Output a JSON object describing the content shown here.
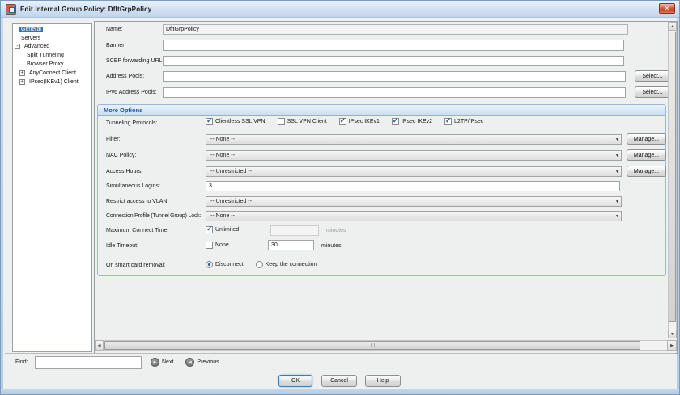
{
  "window": {
    "title": "Edit Internal Group Policy: DfltGrpPolicy"
  },
  "icons": {
    "close": "✕",
    "dropdown_arrow": "▼",
    "check": "✓",
    "next_arrow": "▶",
    "previous_arrow": "◀",
    "scroll_up": "▲",
    "scroll_down": "▼",
    "scroll_left": "◀",
    "scroll_right": "▶",
    "expand_plus": "+",
    "expand_minus": "-"
  },
  "tree": {
    "items": [
      {
        "label": "General",
        "selected": true
      },
      {
        "label": "Servers"
      },
      {
        "label": "Advanced",
        "expander": "-"
      },
      {
        "label": "Split Tunneling"
      },
      {
        "label": "Browser Proxy"
      },
      {
        "label": "AnyConnect Client",
        "expander": "+"
      },
      {
        "label": "IPsec(IKEv1) Client",
        "expander": "+"
      }
    ]
  },
  "form": {
    "name": {
      "label": "Name:",
      "value": "DfltGrpPolicy"
    },
    "banner": {
      "label": "Banner:",
      "value": ""
    },
    "scep": {
      "label": "SCEP forwarding URL:",
      "value": ""
    },
    "address_pools": {
      "label": "Address Pools:",
      "value": "",
      "button": "Select..."
    },
    "ipv6_pools": {
      "label": "IPv6 Address Pools:",
      "value": "",
      "button": "Select..."
    }
  },
  "more_options": {
    "header": "More Options",
    "tunneling": {
      "label": "Tunneling Protocols:",
      "checkboxes": [
        {
          "label": "Clientless SSL VPN",
          "checked": true
        },
        {
          "label": "SSL VPN Client",
          "checked": false
        },
        {
          "label": "IPsec IKEv1",
          "checked": true
        },
        {
          "label": "IPsec IKEv2",
          "checked": true
        },
        {
          "label": "L2TP/IPsec",
          "checked": true
        }
      ]
    },
    "filter": {
      "label": "Filter:",
      "value": "-- None --",
      "button": "Manage..."
    },
    "nac": {
      "label": "NAC Policy:",
      "value": "-- None --",
      "button": "Manage..."
    },
    "access_hours": {
      "label": "Access Hours:",
      "value": "-- Unrestricted --",
      "button": "Manage..."
    },
    "simultaneous": {
      "label": "Simultaneous Logins:",
      "value": "3"
    },
    "vlan": {
      "label": "Restrict access to VLAN:",
      "value": "-- Unrestricted --"
    },
    "tunnel_lock": {
      "label": "Connection Profile (Tunnel Group) Lock:",
      "value": "-- None --"
    },
    "max_connect": {
      "label": "Maximum Connect Time:",
      "checkbox": "Unlimited",
      "checked": true,
      "field": "",
      "unit": "minutes"
    },
    "idle": {
      "label": "Idle Timeout:",
      "checkbox": "None",
      "checked": false,
      "field": "30",
      "unit": "minutes"
    },
    "smart_card": {
      "label": "On smart card removal:",
      "radios": [
        {
          "label": "Disconnect",
          "selected": true
        },
        {
          "label": "Keep the connection",
          "selected": false
        }
      ]
    }
  },
  "find_bar": {
    "label": "Find:",
    "value": "",
    "next": "Next",
    "previous": "Previous"
  },
  "footer": {
    "ok": "OK",
    "cancel": "Cancel",
    "help": "Help"
  },
  "colors": {
    "titlebar": "#cfdff1",
    "dialog_bg": "#eef0ef",
    "selection": "#3472b8",
    "group_header_text": "#2254a8",
    "close_button": "#c94426",
    "check": "#2b5797"
  }
}
